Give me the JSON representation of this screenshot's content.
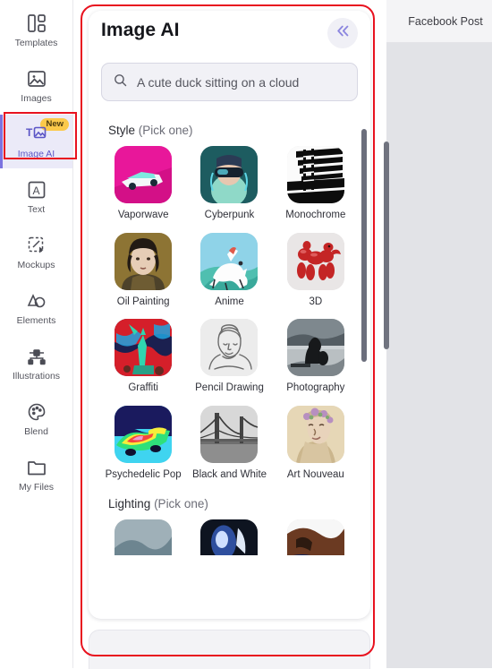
{
  "top_toolbar": {
    "document_label": "Facebook Post"
  },
  "sidebar": {
    "items": [
      {
        "label": "Templates",
        "icon": "templates-icon",
        "active": false,
        "badge": null
      },
      {
        "label": "Images",
        "icon": "images-icon",
        "active": false,
        "badge": null
      },
      {
        "label": "Image AI",
        "icon": "image-ai-icon",
        "active": true,
        "badge": "New"
      },
      {
        "label": "Text",
        "icon": "text-icon",
        "active": false,
        "badge": null
      },
      {
        "label": "Mockups",
        "icon": "mockups-icon",
        "active": false,
        "badge": null
      },
      {
        "label": "Elements",
        "icon": "elements-icon",
        "active": false,
        "badge": null
      },
      {
        "label": "Illustrations",
        "icon": "illustrations-icon",
        "active": false,
        "badge": null
      },
      {
        "label": "Blend",
        "icon": "blend-icon",
        "active": false,
        "badge": null
      },
      {
        "label": "My Files",
        "icon": "my-files-icon",
        "active": false,
        "badge": null
      }
    ]
  },
  "panel": {
    "title": "Image AI",
    "collapse_icon": "double-chevron-left-icon",
    "search": {
      "icon": "search-icon",
      "value": "",
      "placeholder": "A cute duck sitting on a cloud"
    },
    "sections": [
      {
        "title": "Style",
        "hint": "(Pick one)",
        "options": [
          {
            "label": "Vaporwave",
            "thumb": "vaporwave-thumb"
          },
          {
            "label": "Cyberpunk",
            "thumb": "cyberpunk-thumb"
          },
          {
            "label": "Monochrome",
            "thumb": "monochrome-thumb"
          },
          {
            "label": "Oil Painting",
            "thumb": "oil-painting-thumb"
          },
          {
            "label": "Anime",
            "thumb": "anime-thumb"
          },
          {
            "label": "3D",
            "thumb": "3d-thumb"
          },
          {
            "label": "Graffiti",
            "thumb": "graffiti-thumb"
          },
          {
            "label": "Pencil Drawing",
            "thumb": "pencil-drawing-thumb"
          },
          {
            "label": "Photography",
            "thumb": "photography-thumb"
          },
          {
            "label": "Psychedelic Pop",
            "thumb": "psychedelic-pop-thumb"
          },
          {
            "label": "Black and White",
            "thumb": "black-and-white-thumb"
          },
          {
            "label": "Art Nouveau",
            "thumb": "art-nouveau-thumb"
          }
        ]
      },
      {
        "title": "Lighting",
        "hint": "(Pick one)",
        "options": [
          {
            "label": "",
            "thumb": "lighting-thumb-1"
          },
          {
            "label": "",
            "thumb": "lighting-thumb-2"
          },
          {
            "label": "",
            "thumb": "lighting-thumb-3"
          }
        ]
      }
    ]
  },
  "colors": {
    "accent": "#7b73e0",
    "active_bg": "#ebeaf8",
    "badge_bg": "#fbc94a",
    "annotation": "#e8121f",
    "canvas_bg": "#e2e3e7",
    "toolbar_bg": "#f4f4f6"
  }
}
